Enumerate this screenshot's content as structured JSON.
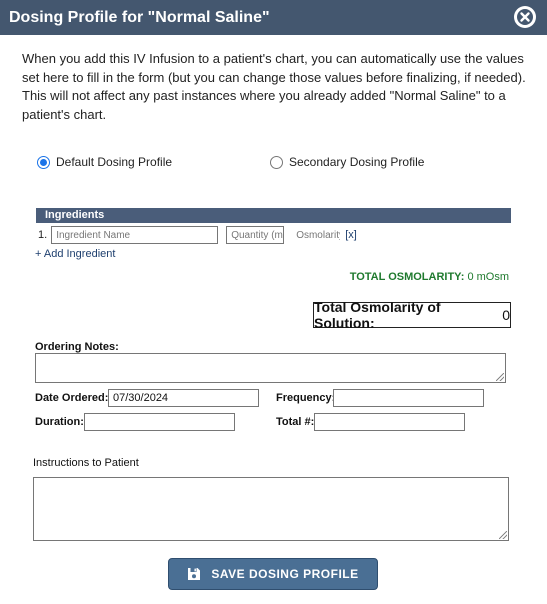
{
  "dialog": {
    "title": "Dosing Profile for \"Normal Saline\"",
    "close_icon": "close-circle-icon"
  },
  "intro_text": "When you add this IV Infusion to a patient's chart, you can automatically use the values set here to fill in the form (but you can change those values before finalizing, if needed). This will not affect any past instances where you already added \"Normal Saline\" to a patient's chart.",
  "profiles": {
    "default_label": "Default Dosing Profile",
    "secondary_label": "Secondary Dosing Profile",
    "selected": "default"
  },
  "ingredients": {
    "header": "Ingredients",
    "rows": [
      {
        "index": "1.",
        "name_placeholder": "Ingredient Name",
        "quantity_placeholder": "Quantity (ml)",
        "osmolarity_placeholder": "Osmolarity",
        "remove_label": "[x]"
      }
    ],
    "add_label": "+ Add Ingredient",
    "total_osm_label": "TOTAL OSMOLARITY:",
    "total_osm_value": "0 mOsm"
  },
  "total_solution": {
    "label": "Total Osmolarity of Solution:",
    "value": "0"
  },
  "form": {
    "ordering_notes_label": "Ordering Notes:",
    "date_ordered_label": "Date Ordered:",
    "date_ordered_value": "07/30/2024",
    "frequency_label": "Frequency:",
    "duration_label": "Duration:",
    "total_label": "Total #:",
    "instructions_label": "Instructions to Patient"
  },
  "save_button": {
    "label": "SAVE DOSING PROFILE",
    "icon": "floppy-disk-icon"
  },
  "colors": {
    "titlebar": "#44576f",
    "ingredients_header": "#4a5d7a",
    "total_osm_green": "#1f7a2e",
    "save_button": "#4a6f94"
  }
}
